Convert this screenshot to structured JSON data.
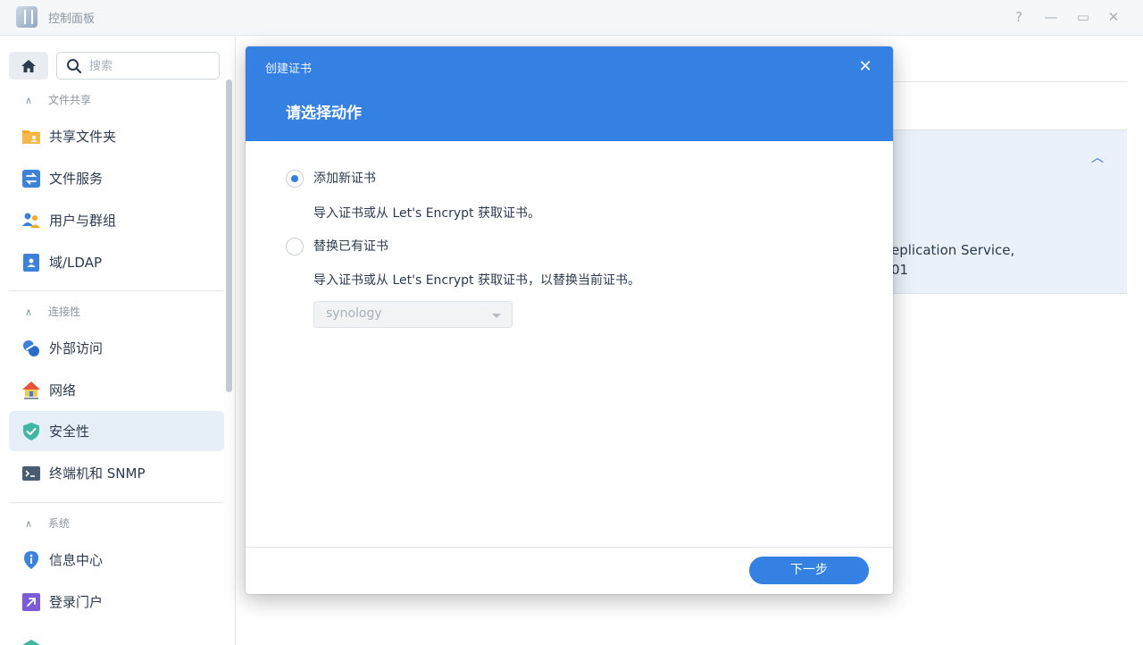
{
  "window": {
    "title": "控制面板",
    "help": "?",
    "minimize": "—",
    "maximize": "▭",
    "close": "✕"
  },
  "sidebar": {
    "search_placeholder": "搜索",
    "sections": [
      {
        "label": "文件共享",
        "items": [
          {
            "label": "共享文件夹",
            "icon": "shared-folder-icon"
          },
          {
            "label": "文件服务",
            "icon": "file-services-icon"
          },
          {
            "label": "用户与群组",
            "icon": "users-groups-icon"
          },
          {
            "label": "域/LDAP",
            "icon": "domain-ldap-icon"
          }
        ]
      },
      {
        "label": "连接性",
        "items": [
          {
            "label": "外部访问",
            "icon": "external-access-icon"
          },
          {
            "label": "网络",
            "icon": "network-icon"
          },
          {
            "label": "安全性",
            "icon": "security-shield-icon",
            "active": true
          },
          {
            "label": "终端机和 SNMP",
            "icon": "terminal-icon"
          }
        ]
      },
      {
        "label": "系统",
        "items": [
          {
            "label": "信息中心",
            "icon": "info-center-icon"
          },
          {
            "label": "登录门户",
            "icon": "login-portal-icon"
          }
        ]
      }
    ]
  },
  "background_panel": {
    "line1": "eplication Service,",
    "line2": "01"
  },
  "dialog": {
    "title": "创建证书",
    "heading": "请选择动作",
    "options": [
      {
        "label": "添加新证书",
        "description": "导入证书或从 Let's Encrypt 获取证书。",
        "checked": true
      },
      {
        "label": "替换已有证书",
        "description": "导入证书或从 Let's Encrypt 获取证书，以替换当前证书。",
        "checked": false
      }
    ],
    "select_value": "synology",
    "next_button": "下一步"
  },
  "colors": {
    "accent": "#3480e3",
    "active_nav_bg": "#e6eef8"
  }
}
